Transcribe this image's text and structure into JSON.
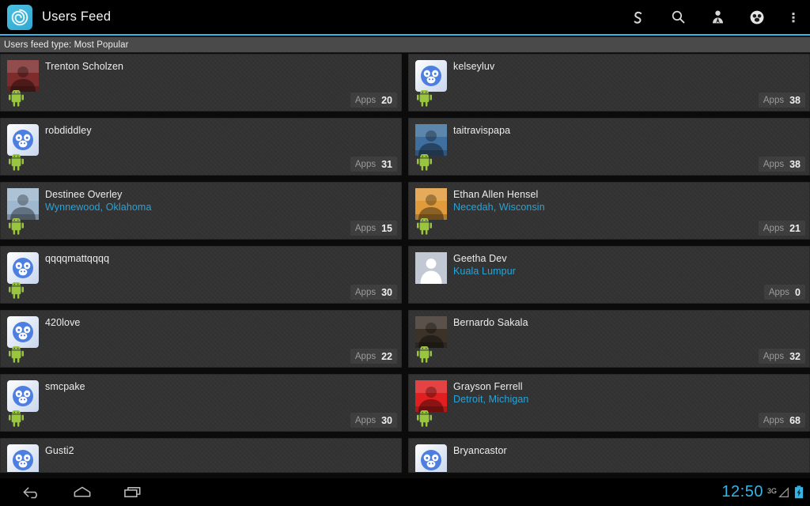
{
  "actionbar": {
    "title": "Users Feed",
    "logo_icon": "spiral-logo-icon",
    "actions": [
      {
        "name": "swirl-icon",
        "label": "Swirl"
      },
      {
        "name": "search-icon",
        "label": "Search"
      },
      {
        "name": "person-icon",
        "label": "Profile"
      },
      {
        "name": "monkey-face-icon",
        "label": "Monkey"
      },
      {
        "name": "overflow-menu-icon",
        "label": "More options"
      }
    ]
  },
  "subbar": {
    "text": "Users feed type: Most Popular"
  },
  "colors": {
    "accent": "#33b5e5",
    "location_text": "#2aa3d6",
    "card_bg": "#333333",
    "actionbar_bg": "#000000",
    "subbar_bg": "#4a4a4a",
    "android_green": "#9ac63f",
    "avatar_blue": "#4d7fe0"
  },
  "apps_label": "Apps",
  "columns": {
    "left": [
      {
        "name": "Trenton Scholzen",
        "location": "",
        "apps": "20",
        "avatar": "photo",
        "avatar_tone": "#7d2b2b",
        "has_droid": true,
        "partial": false
      },
      {
        "name": "robdiddley",
        "location": "",
        "apps": "31",
        "avatar": "monkey",
        "avatar_tone": "",
        "has_droid": true,
        "partial": false
      },
      {
        "name": "Destinee Overley",
        "location": "Wynnewood, Oklahoma",
        "apps": "15",
        "avatar": "photo",
        "avatar_tone": "#9fb7cf",
        "has_droid": true,
        "partial": false
      },
      {
        "name": "qqqqmattqqqq",
        "location": "",
        "apps": "30",
        "avatar": "monkey",
        "avatar_tone": "",
        "has_droid": true,
        "partial": false
      },
      {
        "name": "420love",
        "location": "",
        "apps": "22",
        "avatar": "monkey",
        "avatar_tone": "",
        "has_droid": true,
        "partial": false
      },
      {
        "name": "smcpake",
        "location": "",
        "apps": "30",
        "avatar": "monkey",
        "avatar_tone": "",
        "has_droid": true,
        "partial": false
      },
      {
        "name": "Gusti2",
        "location": "",
        "apps": "",
        "avatar": "monkey",
        "avatar_tone": "",
        "has_droid": false,
        "partial": true
      }
    ],
    "right": [
      {
        "name": "kelseyluv",
        "location": "",
        "apps": "38",
        "avatar": "monkey",
        "avatar_tone": "",
        "has_droid": true,
        "partial": false
      },
      {
        "name": "taitravispapa",
        "location": "",
        "apps": "38",
        "avatar": "photo",
        "avatar_tone": "#3f6f9e",
        "has_droid": true,
        "partial": false
      },
      {
        "name": "Ethan Allen Hensel",
        "location": "Necedah, Wisconsin",
        "apps": "21",
        "avatar": "photo",
        "avatar_tone": "#e09b3c",
        "has_droid": true,
        "partial": false
      },
      {
        "name": "Geetha Dev",
        "location": "Kuala Lumpur",
        "apps": "0",
        "avatar": "placeholder",
        "avatar_tone": "",
        "has_droid": false,
        "partial": false
      },
      {
        "name": "Bernardo Sakala",
        "location": "",
        "apps": "32",
        "avatar": "photo",
        "avatar_tone": "#3b3228",
        "has_droid": true,
        "partial": false
      },
      {
        "name": "Grayson Ferrell",
        "location": "Detroit, Michigan",
        "apps": "68",
        "avatar": "photo",
        "avatar_tone": "#e02020",
        "has_droid": true,
        "partial": false
      },
      {
        "name": "Bryancastor",
        "location": "",
        "apps": "",
        "avatar": "monkey",
        "avatar_tone": "",
        "has_droid": false,
        "partial": true
      }
    ]
  },
  "navbar": {
    "buttons": [
      {
        "name": "back-button",
        "label": "Back"
      },
      {
        "name": "home-button",
        "label": "Home"
      },
      {
        "name": "recents-button",
        "label": "Recent apps"
      }
    ],
    "clock": "12:50",
    "network": "3G",
    "signal_icon": "signal-triangle-icon",
    "battery_icon": "battery-charging-icon"
  }
}
